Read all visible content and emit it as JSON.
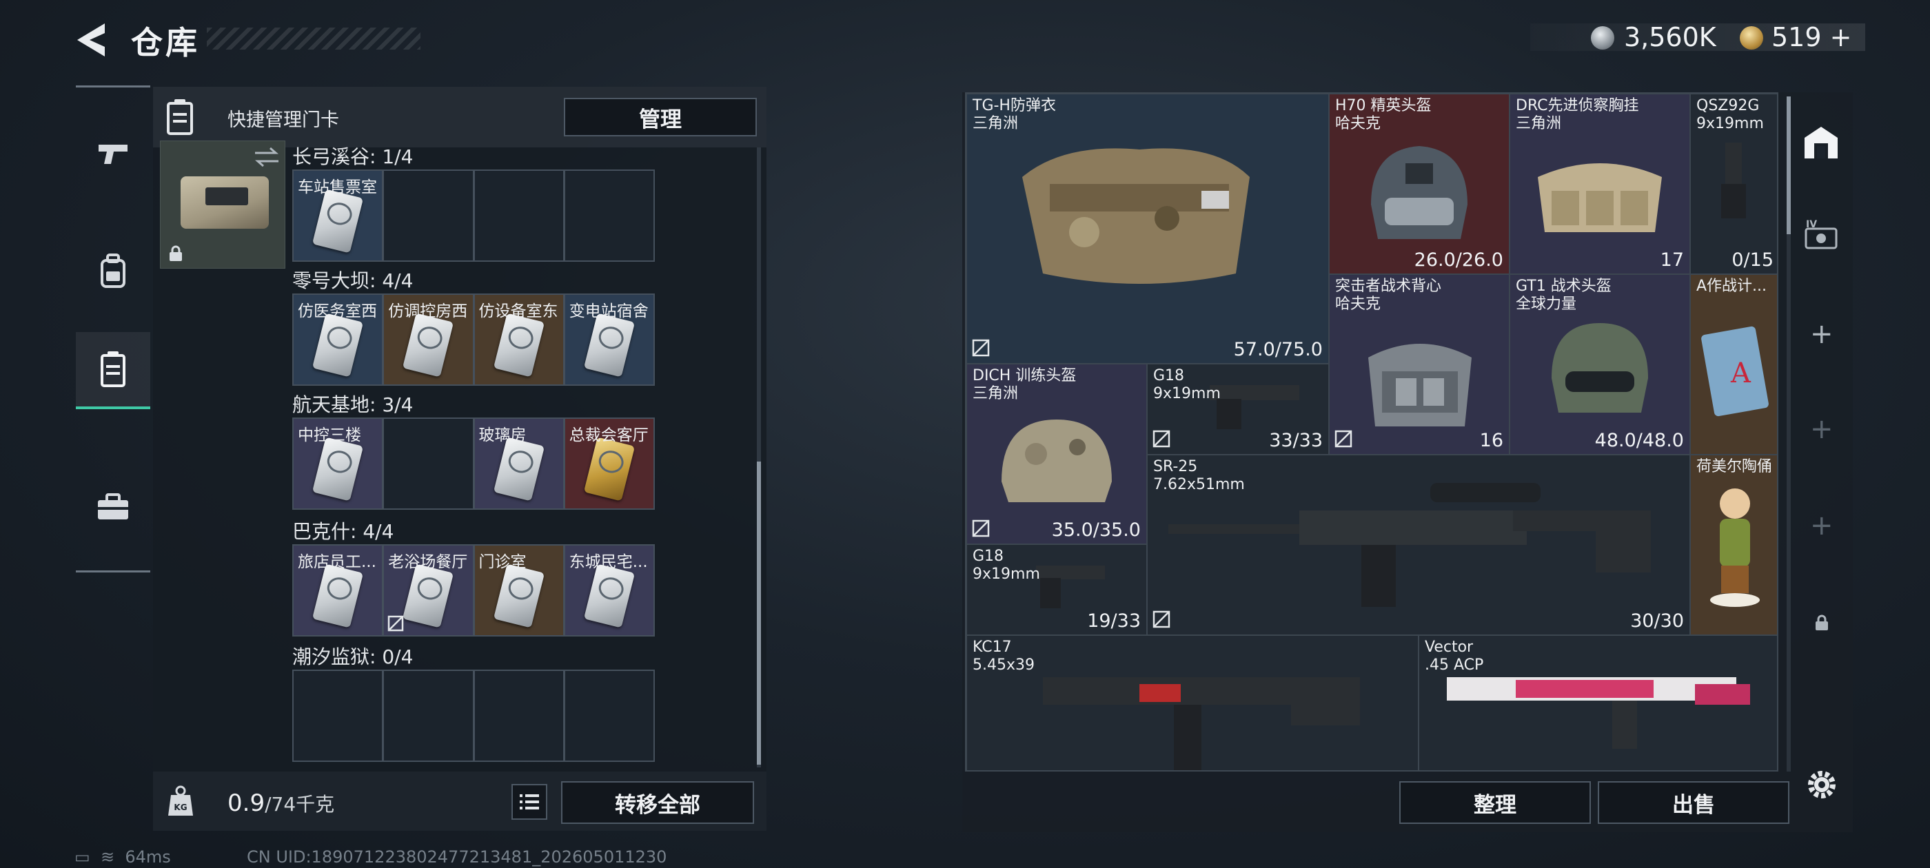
{
  "header": {
    "title": "仓库",
    "currency_silver": "3,560K",
    "currency_gold": "519"
  },
  "rail": {
    "items": [
      {
        "icon": "pistol-icon"
      },
      {
        "icon": "backpack-icon"
      },
      {
        "icon": "keycard-case-icon",
        "active": true
      },
      {
        "icon": "toolbox-icon"
      }
    ]
  },
  "left_panel": {
    "header_label": "快捷管理门卡",
    "manage_label": "管理",
    "groups": [
      {
        "title": "长弓溪谷: 1/4",
        "slots": [
          {
            "label": "车站售票室",
            "color": "blue",
            "card": "silver"
          },
          {
            "label": "",
            "color": "",
            "card": ""
          },
          {
            "label": "",
            "color": "",
            "card": ""
          },
          {
            "label": "",
            "color": "",
            "card": ""
          }
        ]
      },
      {
        "title": "零号大坝: 4/4",
        "slots": [
          {
            "label": "仿医务室西",
            "color": "blue",
            "card": "silver"
          },
          {
            "label": "仿调控房西",
            "color": "gold",
            "card": "silver"
          },
          {
            "label": "仿设备室东",
            "color": "gold",
            "card": "silver"
          },
          {
            "label": "变电站宿舍",
            "color": "blue",
            "card": "silver"
          }
        ]
      },
      {
        "title": "航天基地: 3/4",
        "slots": [
          {
            "label": "中控三楼",
            "color": "purple",
            "card": "silver"
          },
          {
            "label": "",
            "color": "",
            "card": ""
          },
          {
            "label": "玻璃房",
            "color": "purple",
            "card": "silver"
          },
          {
            "label": "总裁会客厅",
            "color": "red",
            "card": "gold"
          }
        ]
      },
      {
        "title": "巴克什: 4/4",
        "slots": [
          {
            "label": "旅店员工...",
            "color": "purple",
            "card": "silver"
          },
          {
            "label": "老浴场餐厅",
            "color": "purple",
            "card": "silver",
            "nodrop": true
          },
          {
            "label": "门诊室",
            "color": "gold",
            "card": "silver"
          },
          {
            "label": "东城民宅...",
            "color": "purple",
            "card": "silver"
          }
        ]
      },
      {
        "title": "潮汐监狱: 0/4",
        "slots": [
          {
            "label": "",
            "color": "",
            "card": ""
          },
          {
            "label": "",
            "color": "",
            "card": ""
          },
          {
            "label": "",
            "color": "",
            "card": ""
          },
          {
            "label": "",
            "color": "",
            "card": ""
          }
        ]
      }
    ],
    "weight_value": "0.9",
    "weight_unit": "/74千克",
    "transfer_label": "转移全部"
  },
  "status": {
    "ping": "64ms",
    "uid": "CN UID:1890712238024772134​81_202605011230"
  },
  "stash": {
    "items": [
      {
        "id": "tg-h-armor",
        "name": "TG-H防弹衣",
        "sub": "三角洲",
        "value": "57.0/75.0",
        "color": "blue",
        "nodrop": true
      },
      {
        "id": "h70-helmet",
        "name": "H70 精英头盔",
        "sub": "哈夫克",
        "value": "26.0/26.0",
        "color": "red",
        "nodrop": false
      },
      {
        "id": "drc-rig",
        "name": "DRC先进侦察胸挂",
        "sub": "三角洲",
        "value": "17",
        "color": "purple",
        "nodrop": false
      },
      {
        "id": "qsz92g",
        "name": "QSZ92G",
        "sub": "9x19mm",
        "value": "0/15",
        "color": "",
        "nodrop": false
      },
      {
        "id": "assault-backpack",
        "name": "突击者战术背心",
        "sub": "哈夫克",
        "value": "16",
        "color": "purple",
        "nodrop": true
      },
      {
        "id": "gt1-helmet",
        "name": "GT1 战术头盔",
        "sub": "全球力量",
        "value": "48.0/48.0",
        "color": "purple",
        "nodrop": false
      },
      {
        "id": "a-card",
        "name": "A作战计...",
        "sub": "",
        "value": "",
        "color": "gold",
        "nodrop": false
      },
      {
        "id": "dich-helmet",
        "name": "DICH 训练头盔",
        "sub": "三角洲",
        "value": "35.0/35.0",
        "color": "purple",
        "nodrop": true
      },
      {
        "id": "g18-a",
        "name": "G18",
        "sub": "9x19mm",
        "value": "33/33",
        "color": "",
        "nodrop": true
      },
      {
        "id": "sr-25",
        "name": "SR-25",
        "sub": "7.62x51mm",
        "value": "30/30",
        "color": "",
        "nodrop": true
      },
      {
        "id": "hummel",
        "name": "荷美尔陶俑",
        "sub": "",
        "value": "",
        "color": "gold",
        "nodrop": false
      },
      {
        "id": "g18-b",
        "name": "G18",
        "sub": "9x19mm",
        "value": "19/33",
        "color": "",
        "nodrop": false
      },
      {
        "id": "kc17",
        "name": "KC17",
        "sub": "5.45x39",
        "value": "",
        "color": "",
        "nodrop": false
      },
      {
        "id": "vector",
        "name": "Vector",
        "sub": ".45 ACP",
        "value": "",
        "color": "",
        "nodrop": false
      }
    ],
    "sort_label": "整理",
    "sell_label": "出售"
  },
  "side_toolbar": {
    "items": [
      "home-icon",
      "iv-card-icon",
      "plus-icon",
      "plus-icon",
      "plus-icon",
      "lock-icon"
    ]
  },
  "colors": {
    "accent": "#3fc9a6",
    "slot_blue": "#2c3d52",
    "slot_purple": "#3a3b56",
    "slot_gold": "#4b3c2c",
    "slot_red": "#51282c"
  }
}
